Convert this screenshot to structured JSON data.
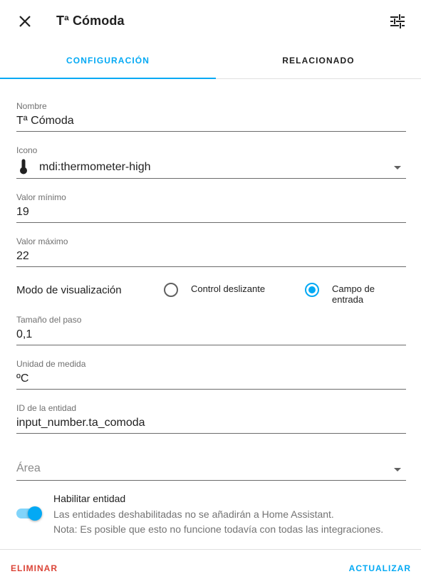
{
  "header": {
    "title": "Tª Cómoda",
    "close_icon": "close-icon",
    "settings_icon": "tune-icon"
  },
  "tabs": [
    {
      "label": "CONFIGURACIÓN",
      "active": true
    },
    {
      "label": "RELACIONADO",
      "active": false
    }
  ],
  "form": {
    "nombre": {
      "label": "Nombre",
      "value": "Tª Cómoda"
    },
    "icono": {
      "label": "Icono",
      "value": "mdi:thermometer-high",
      "icon": "thermometer-high-icon"
    },
    "valor_minimo": {
      "label": "Valor mínimo",
      "value": "19"
    },
    "valor_maximo": {
      "label": "Valor máximo",
      "value": "22"
    },
    "modo": {
      "label": "Modo de visualización",
      "options": [
        "Control deslizante",
        "Campo de entrada"
      ],
      "selected": "Campo de entrada"
    },
    "tamano_paso": {
      "label": "Tamaño del paso",
      "value": "0,1"
    },
    "unidad": {
      "label": "Unidad de medida",
      "value": "ºC"
    },
    "entidad_id": {
      "label": "ID de la entidad",
      "value": "input_number.ta_comoda"
    },
    "area": {
      "placeholder": "Área",
      "value": ""
    }
  },
  "enable": {
    "title": "Habilitar entidad",
    "description_1": "Las entidades deshabilitadas no se añadirán a Home Assistant.",
    "description_2": "Nota: Es posible que esto no funcione todavía con todas las integraciones.",
    "enabled": true
  },
  "footer": {
    "delete_label": "ELIMINAR",
    "update_label": "ACTUALIZAR"
  },
  "colors": {
    "accent": "#03a9f4",
    "danger": "#db4437",
    "text": "#212121",
    "secondary": "#737373"
  }
}
